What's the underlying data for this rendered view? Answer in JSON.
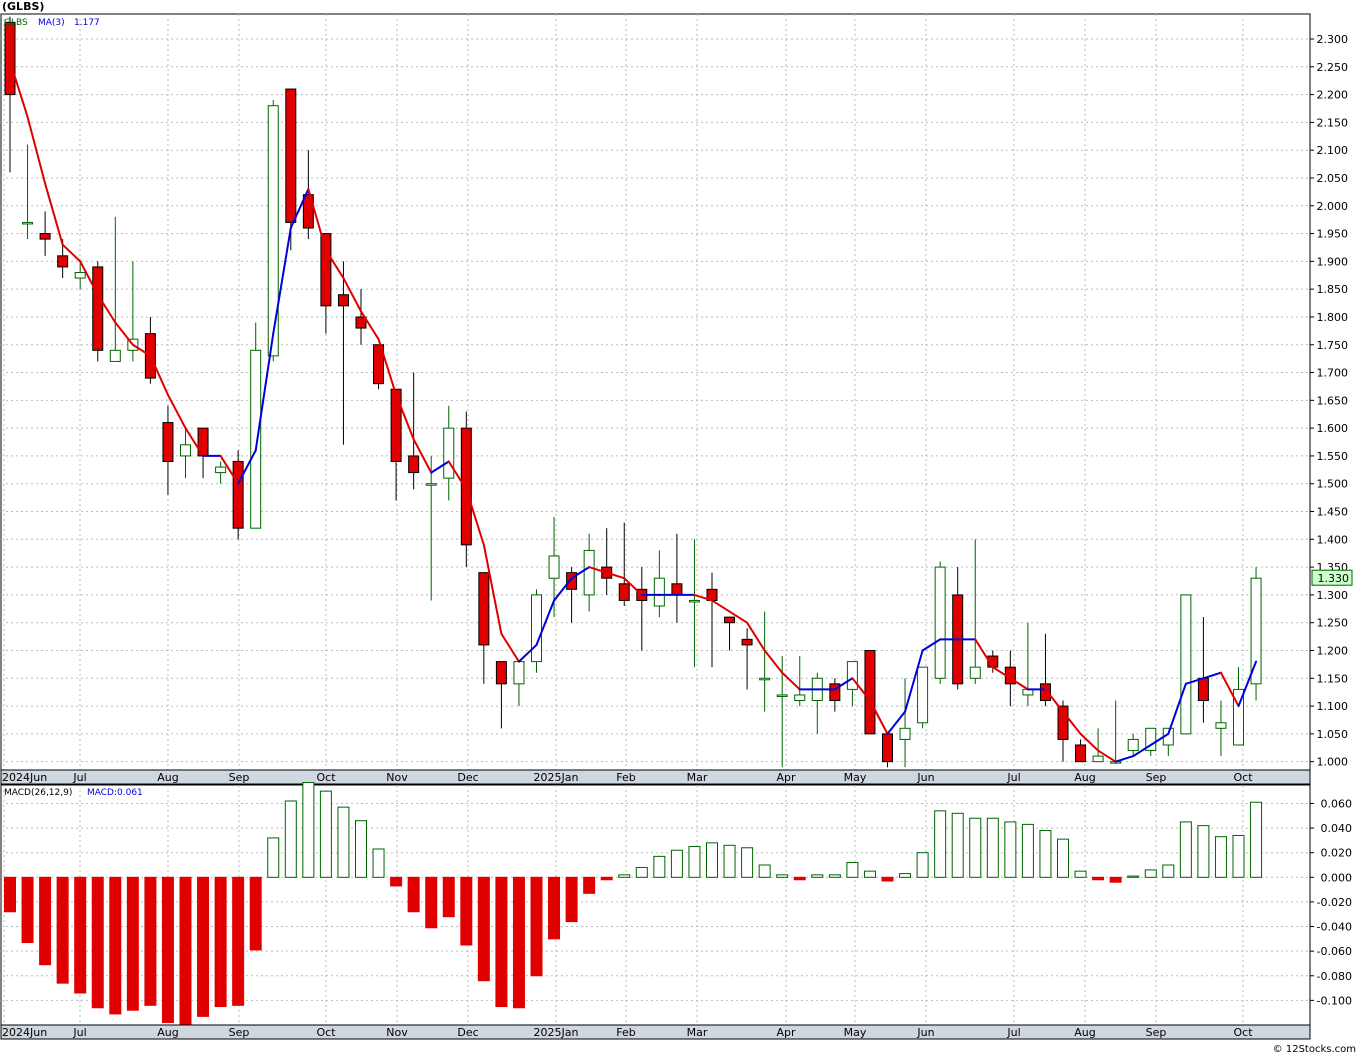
{
  "header": {
    "ticker_title": "(GLBS)",
    "series_label": "GLBS",
    "ma_label": "MA(3)",
    "ma_value": "1.177",
    "last_price": "1.330",
    "macd_label": "MACD(26,12,9)",
    "macd_value_label": "MACD:0.061",
    "footer": "© 12Stocks.com"
  },
  "colors": {
    "up": "#006400",
    "down": "#e00000",
    "ma_up": "#0000dd",
    "ma_down": "#e00000",
    "grid": "#bbbbbb",
    "axis_bar": "#cfd8e0",
    "last_price_bg": "#ccffcc"
  },
  "chart_data": [
    {
      "type": "candlestick",
      "title": "(GLBS)",
      "legend": [
        "GLBS",
        "MA(3) 1.177"
      ],
      "ylim": [
        0.985,
        2.345
      ],
      "y_ticks": [
        "1.000",
        "1.050",
        "1.100",
        "1.150",
        "1.200",
        "1.250",
        "1.300",
        "1.350",
        "1.400",
        "1.450",
        "1.500",
        "1.550",
        "1.600",
        "1.650",
        "1.700",
        "1.750",
        "1.800",
        "1.850",
        "1.900",
        "1.950",
        "2.000",
        "2.050",
        "2.100",
        "2.150",
        "2.200",
        "2.250",
        "2.300"
      ],
      "x_labels": [
        "2024Jun",
        "Jul",
        "Aug",
        "Sep",
        "Oct",
        "Nov",
        "Dec",
        "2025Jan",
        "Feb",
        "Mar",
        "Apr",
        "May",
        "Jun",
        "Jul",
        "Aug",
        "Sep",
        "Oct"
      ],
      "grid": true,
      "candles": [
        {
          "o": 2.33,
          "h": 2.34,
          "l": 2.06,
          "c": 2.2
        },
        {
          "o": 1.97,
          "h": 2.11,
          "l": 1.94,
          "c": 1.97
        },
        {
          "o": 1.95,
          "h": 1.99,
          "l": 1.91,
          "c": 1.94
        },
        {
          "o": 1.91,
          "h": 1.94,
          "l": 1.87,
          "c": 1.89
        },
        {
          "o": 1.87,
          "h": 1.9,
          "l": 1.85,
          "c": 1.88
        },
        {
          "o": 1.89,
          "h": 1.9,
          "l": 1.72,
          "c": 1.74
        },
        {
          "o": 1.72,
          "h": 1.98,
          "l": 1.72,
          "c": 1.74
        },
        {
          "o": 1.74,
          "h": 1.9,
          "l": 1.72,
          "c": 1.76
        },
        {
          "o": 1.77,
          "h": 1.8,
          "l": 1.68,
          "c": 1.69
        },
        {
          "o": 1.61,
          "h": 1.64,
          "l": 1.48,
          "c": 1.54
        },
        {
          "o": 1.55,
          "h": 1.6,
          "l": 1.51,
          "c": 1.57
        },
        {
          "o": 1.6,
          "h": 1.6,
          "l": 1.51,
          "c": 1.55
        },
        {
          "o": 1.52,
          "h": 1.54,
          "l": 1.5,
          "c": 1.53
        },
        {
          "o": 1.54,
          "h": 1.56,
          "l": 1.4,
          "c": 1.42
        },
        {
          "o": 1.42,
          "h": 1.79,
          "l": 1.42,
          "c": 1.74
        },
        {
          "o": 1.73,
          "h": 2.19,
          "l": 1.72,
          "c": 2.18
        },
        {
          "o": 2.21,
          "h": 2.21,
          "l": 1.92,
          "c": 1.97
        },
        {
          "o": 2.02,
          "h": 2.1,
          "l": 1.94,
          "c": 1.96
        },
        {
          "o": 1.95,
          "h": 1.95,
          "l": 1.77,
          "c": 1.82
        },
        {
          "o": 1.84,
          "h": 1.9,
          "l": 1.57,
          "c": 1.82
        },
        {
          "o": 1.8,
          "h": 1.85,
          "l": 1.75,
          "c": 1.78
        },
        {
          "o": 1.75,
          "h": 1.75,
          "l": 1.67,
          "c": 1.68
        },
        {
          "o": 1.67,
          "h": 1.67,
          "l": 1.47,
          "c": 1.54
        },
        {
          "o": 1.55,
          "h": 1.7,
          "l": 1.49,
          "c": 1.52
        },
        {
          "o": 1.5,
          "h": 1.55,
          "l": 1.29,
          "c": 1.5
        },
        {
          "o": 1.51,
          "h": 1.64,
          "l": 1.47,
          "c": 1.6
        },
        {
          "o": 1.6,
          "h": 1.63,
          "l": 1.35,
          "c": 1.39
        },
        {
          "o": 1.34,
          "h": 1.34,
          "l": 1.14,
          "c": 1.21
        },
        {
          "o": 1.18,
          "h": 1.18,
          "l": 1.06,
          "c": 1.14
        },
        {
          "o": 1.14,
          "h": 1.18,
          "l": 1.1,
          "c": 1.18
        },
        {
          "o": 1.18,
          "h": 1.31,
          "l": 1.16,
          "c": 1.3
        },
        {
          "o": 1.33,
          "h": 1.44,
          "l": 1.26,
          "c": 1.37
        },
        {
          "o": 1.34,
          "h": 1.35,
          "l": 1.25,
          "c": 1.31
        },
        {
          "o": 1.3,
          "h": 1.41,
          "l": 1.27,
          "c": 1.38
        },
        {
          "o": 1.35,
          "h": 1.42,
          "l": 1.3,
          "c": 1.33
        },
        {
          "o": 1.32,
          "h": 1.43,
          "l": 1.28,
          "c": 1.29
        },
        {
          "o": 1.31,
          "h": 1.35,
          "l": 1.2,
          "c": 1.29
        },
        {
          "o": 1.28,
          "h": 1.38,
          "l": 1.26,
          "c": 1.33
        },
        {
          "o": 1.32,
          "h": 1.41,
          "l": 1.25,
          "c": 1.3
        },
        {
          "o": 1.29,
          "h": 1.4,
          "l": 1.17,
          "c": 1.29
        },
        {
          "o": 1.31,
          "h": 1.34,
          "l": 1.17,
          "c": 1.29
        },
        {
          "o": 1.26,
          "h": 1.26,
          "l": 1.2,
          "c": 1.25
        },
        {
          "o": 1.22,
          "h": 1.24,
          "l": 1.13,
          "c": 1.21
        },
        {
          "o": 1.15,
          "h": 1.27,
          "l": 1.09,
          "c": 1.15
        },
        {
          "o": 1.12,
          "h": 1.19,
          "l": 0.99,
          "c": 1.12
        },
        {
          "o": 1.11,
          "h": 1.19,
          "l": 1.1,
          "c": 1.12
        },
        {
          "o": 1.11,
          "h": 1.16,
          "l": 1.05,
          "c": 1.15
        },
        {
          "o": 1.14,
          "h": 1.15,
          "l": 1.09,
          "c": 1.11
        },
        {
          "o": 1.13,
          "h": 1.18,
          "l": 1.1,
          "c": 1.18
        },
        {
          "o": 1.2,
          "h": 1.2,
          "l": 1.05,
          "c": 1.05
        },
        {
          "o": 1.05,
          "h": 1.05,
          "l": 0.99,
          "c": 1.0
        },
        {
          "o": 1.04,
          "h": 1.15,
          "l": 0.99,
          "c": 1.06
        },
        {
          "o": 1.07,
          "h": 1.17,
          "l": 1.06,
          "c": 1.17
        },
        {
          "o": 1.15,
          "h": 1.36,
          "l": 1.14,
          "c": 1.35
        },
        {
          "o": 1.3,
          "h": 1.35,
          "l": 1.13,
          "c": 1.14
        },
        {
          "o": 1.15,
          "h": 1.4,
          "l": 1.14,
          "c": 1.17
        },
        {
          "o": 1.19,
          "h": 1.2,
          "l": 1.16,
          "c": 1.17
        },
        {
          "o": 1.17,
          "h": 1.2,
          "l": 1.1,
          "c": 1.14
        },
        {
          "o": 1.12,
          "h": 1.25,
          "l": 1.1,
          "c": 1.13
        },
        {
          "o": 1.14,
          "h": 1.23,
          "l": 1.1,
          "c": 1.11
        },
        {
          "o": 1.1,
          "h": 1.11,
          "l": 1.0,
          "c": 1.04
        },
        {
          "o": 1.03,
          "h": 1.04,
          "l": 1.0,
          "c": 1.0
        },
        {
          "o": 1.0,
          "h": 1.06,
          "l": 1.0,
          "c": 1.01
        },
        {
          "o": 1.0,
          "h": 1.11,
          "l": 1.0,
          "c": 1.0
        },
        {
          "o": 1.02,
          "h": 1.05,
          "l": 1.01,
          "c": 1.04
        },
        {
          "o": 1.02,
          "h": 1.06,
          "l": 1.01,
          "c": 1.06
        },
        {
          "o": 1.03,
          "h": 1.06,
          "l": 1.01,
          "c": 1.06
        },
        {
          "o": 1.05,
          "h": 1.3,
          "l": 1.05,
          "c": 1.3
        },
        {
          "o": 1.15,
          "h": 1.26,
          "l": 1.07,
          "c": 1.11
        },
        {
          "o": 1.06,
          "h": 1.11,
          "l": 1.01,
          "c": 1.07
        },
        {
          "o": 1.03,
          "h": 1.17,
          "l": 1.03,
          "c": 1.13
        },
        {
          "o": 1.14,
          "h": 1.35,
          "l": 1.11,
          "c": 1.33
        }
      ],
      "ma3": [
        2.26,
        2.16,
        2.04,
        1.93,
        1.9,
        1.84,
        1.79,
        1.75,
        1.73,
        1.66,
        1.6,
        1.55,
        1.55,
        1.5,
        1.56,
        1.77,
        1.96,
        2.03,
        1.92,
        1.87,
        1.81,
        1.76,
        1.66,
        1.58,
        1.52,
        1.54,
        1.49,
        1.39,
        1.23,
        1.18,
        1.21,
        1.29,
        1.33,
        1.35,
        1.34,
        1.33,
        1.3,
        1.3,
        1.3,
        1.3,
        1.29,
        1.27,
        1.25,
        1.2,
        1.16,
        1.13,
        1.13,
        1.13,
        1.15,
        1.11,
        1.05,
        1.09,
        1.2,
        1.22,
        1.22,
        1.22,
        1.17,
        1.15,
        1.13,
        1.13,
        1.09,
        1.05,
        1.02,
        1.0,
        1.01,
        1.03,
        1.05,
        1.14,
        1.15,
        1.16,
        1.1,
        1.18
      ]
    },
    {
      "type": "bar",
      "title": "MACD(26,12,9)",
      "legend": [
        "MACD:0.061"
      ],
      "ylim": [
        -0.12,
        0.075
      ],
      "y_ticks": [
        "0.060",
        "0.040",
        "0.020",
        "0.000",
        "-0.020",
        "-0.040",
        "-0.060",
        "-0.080",
        "-0.100"
      ],
      "x_labels": [
        "2024Jun",
        "Jul",
        "Aug",
        "Sep",
        "Oct",
        "Nov",
        "Dec",
        "2025Jan",
        "Feb",
        "Mar",
        "Apr",
        "May",
        "Jun",
        "Jul",
        "Aug",
        "Sep",
        "Oct"
      ],
      "values": [
        -0.028,
        -0.053,
        -0.071,
        -0.086,
        -0.094,
        -0.106,
        -0.111,
        -0.108,
        -0.104,
        -0.118,
        -0.12,
        -0.113,
        -0.105,
        -0.104,
        -0.059,
        0.032,
        0.062,
        0.077,
        0.07,
        0.057,
        0.046,
        0.023,
        -0.007,
        -0.028,
        -0.041,
        -0.032,
        -0.055,
        -0.084,
        -0.105,
        -0.106,
        -0.08,
        -0.05,
        -0.036,
        -0.013,
        -0.002,
        0.002,
        0.008,
        0.017,
        0.022,
        0.025,
        0.028,
        0.026,
        0.024,
        0.01,
        0.002,
        -0.002,
        0.002,
        0.002,
        0.012,
        0.005,
        -0.003,
        0.003,
        0.02,
        0.054,
        0.052,
        0.048,
        0.048,
        0.045,
        0.043,
        0.038,
        0.031,
        0.005,
        -0.002,
        -0.004,
        0.001,
        0.006,
        0.01,
        0.045,
        0.042,
        0.033,
        0.034,
        0.061
      ]
    }
  ]
}
